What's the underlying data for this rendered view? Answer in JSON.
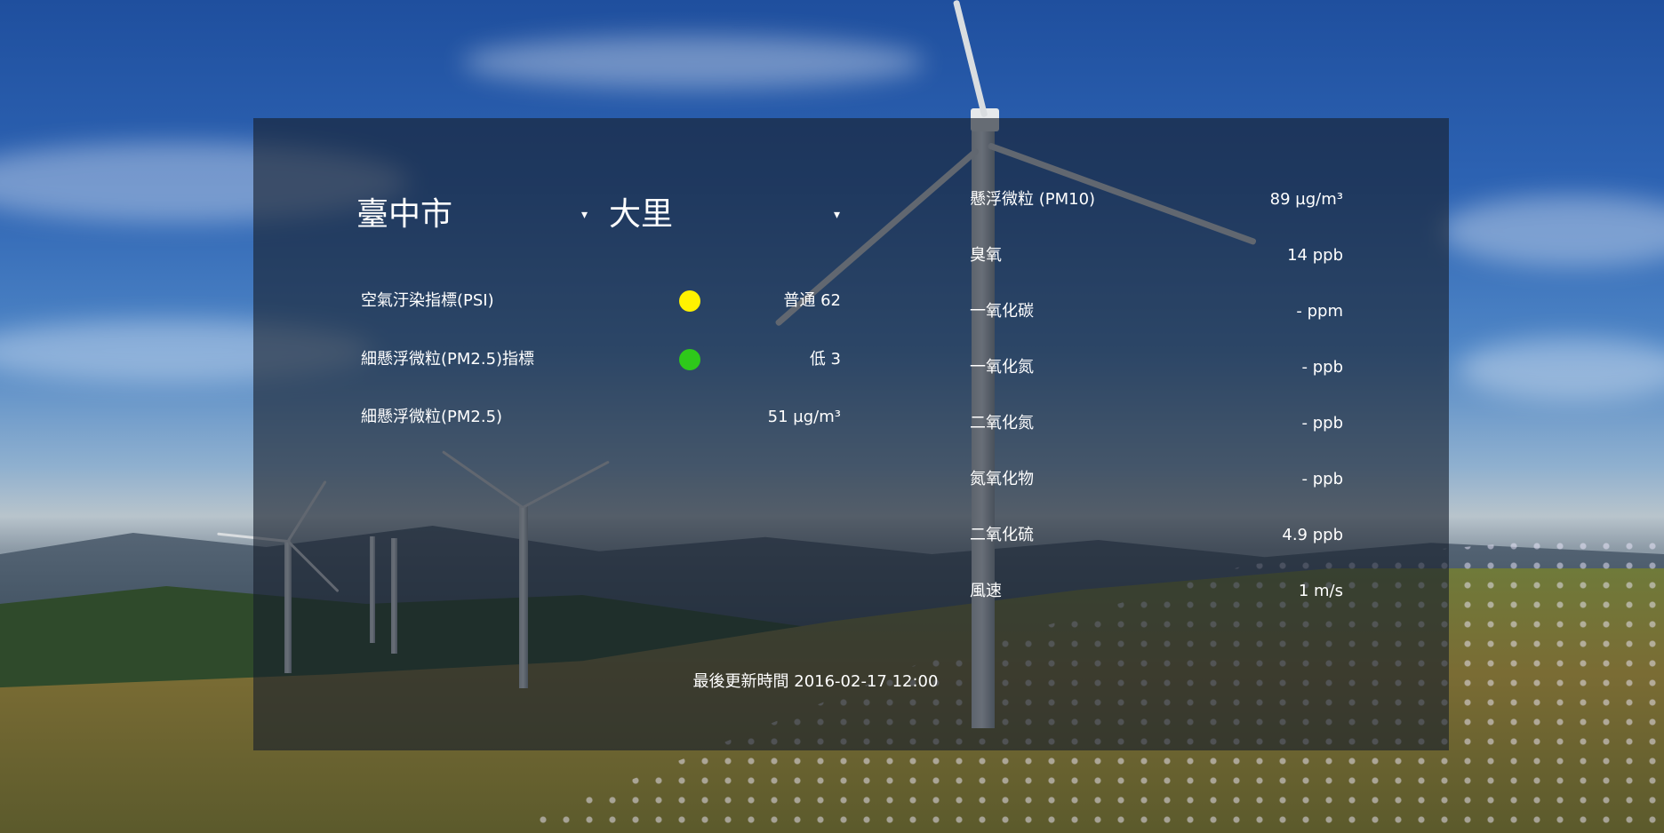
{
  "location": {
    "city": "臺中市",
    "district": "大里",
    "dropdown_arrow": "▾"
  },
  "indices": [
    {
      "label": "空氣汙染指標(PSI)",
      "value": "普通 62",
      "dot_color": "#fff200"
    },
    {
      "label": "細懸浮微粒(PM2.5)指標",
      "value": "低 3",
      "dot_color": "#2ec81a"
    },
    {
      "label": "細懸浮微粒(PM2.5)",
      "value": "51 µg/m³"
    }
  ],
  "measurements": [
    {
      "label": "懸浮微粒 (PM10)",
      "value": "89 µg/m³"
    },
    {
      "label": "臭氧",
      "value": "14 ppb"
    },
    {
      "label": "一氧化碳",
      "value": "- ppm"
    },
    {
      "label": "一氧化氮",
      "value": "- ppb"
    },
    {
      "label": "二氧化氮",
      "value": "- ppb"
    },
    {
      "label": "氮氧化物",
      "value": "- ppb"
    },
    {
      "label": "二氧化硫",
      "value": "4.9 ppb"
    },
    {
      "label": "風速",
      "value": "1 m/s"
    }
  ],
  "footer": {
    "last_updated": "最後更新時間 2016-02-17 12:00"
  }
}
